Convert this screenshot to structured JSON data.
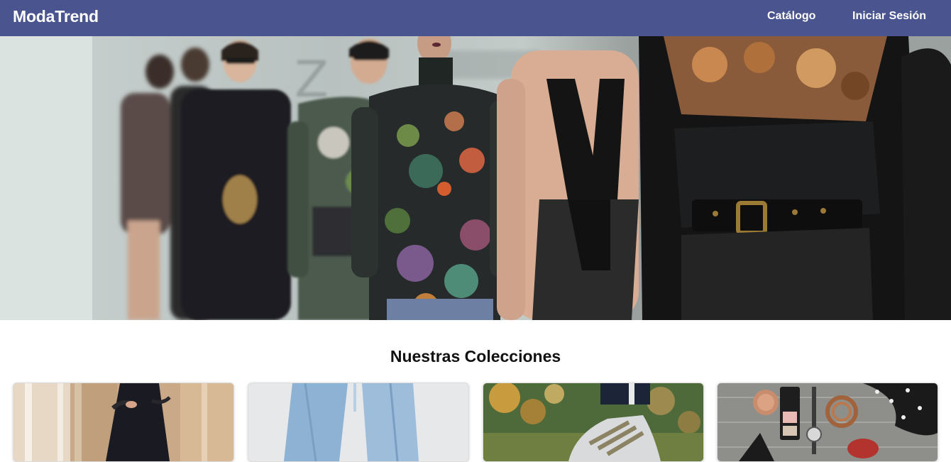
{
  "navbar": {
    "brand": "ModaTrend",
    "links": [
      {
        "label": "Catálogo"
      },
      {
        "label": "Iniciar Sesión"
      }
    ],
    "background_color": "#4a548e"
  },
  "hero": {
    "image_subject": "fashion-runway-photo"
  },
  "collections": {
    "title": "Nuestras Colecciones",
    "cards": [
      {
        "image_subject": "black-dress-photo"
      },
      {
        "image_subject": "blue-jeans-photo"
      },
      {
        "image_subject": "sneakers-photo"
      },
      {
        "image_subject": "accessories-flatlay-photo"
      }
    ]
  }
}
